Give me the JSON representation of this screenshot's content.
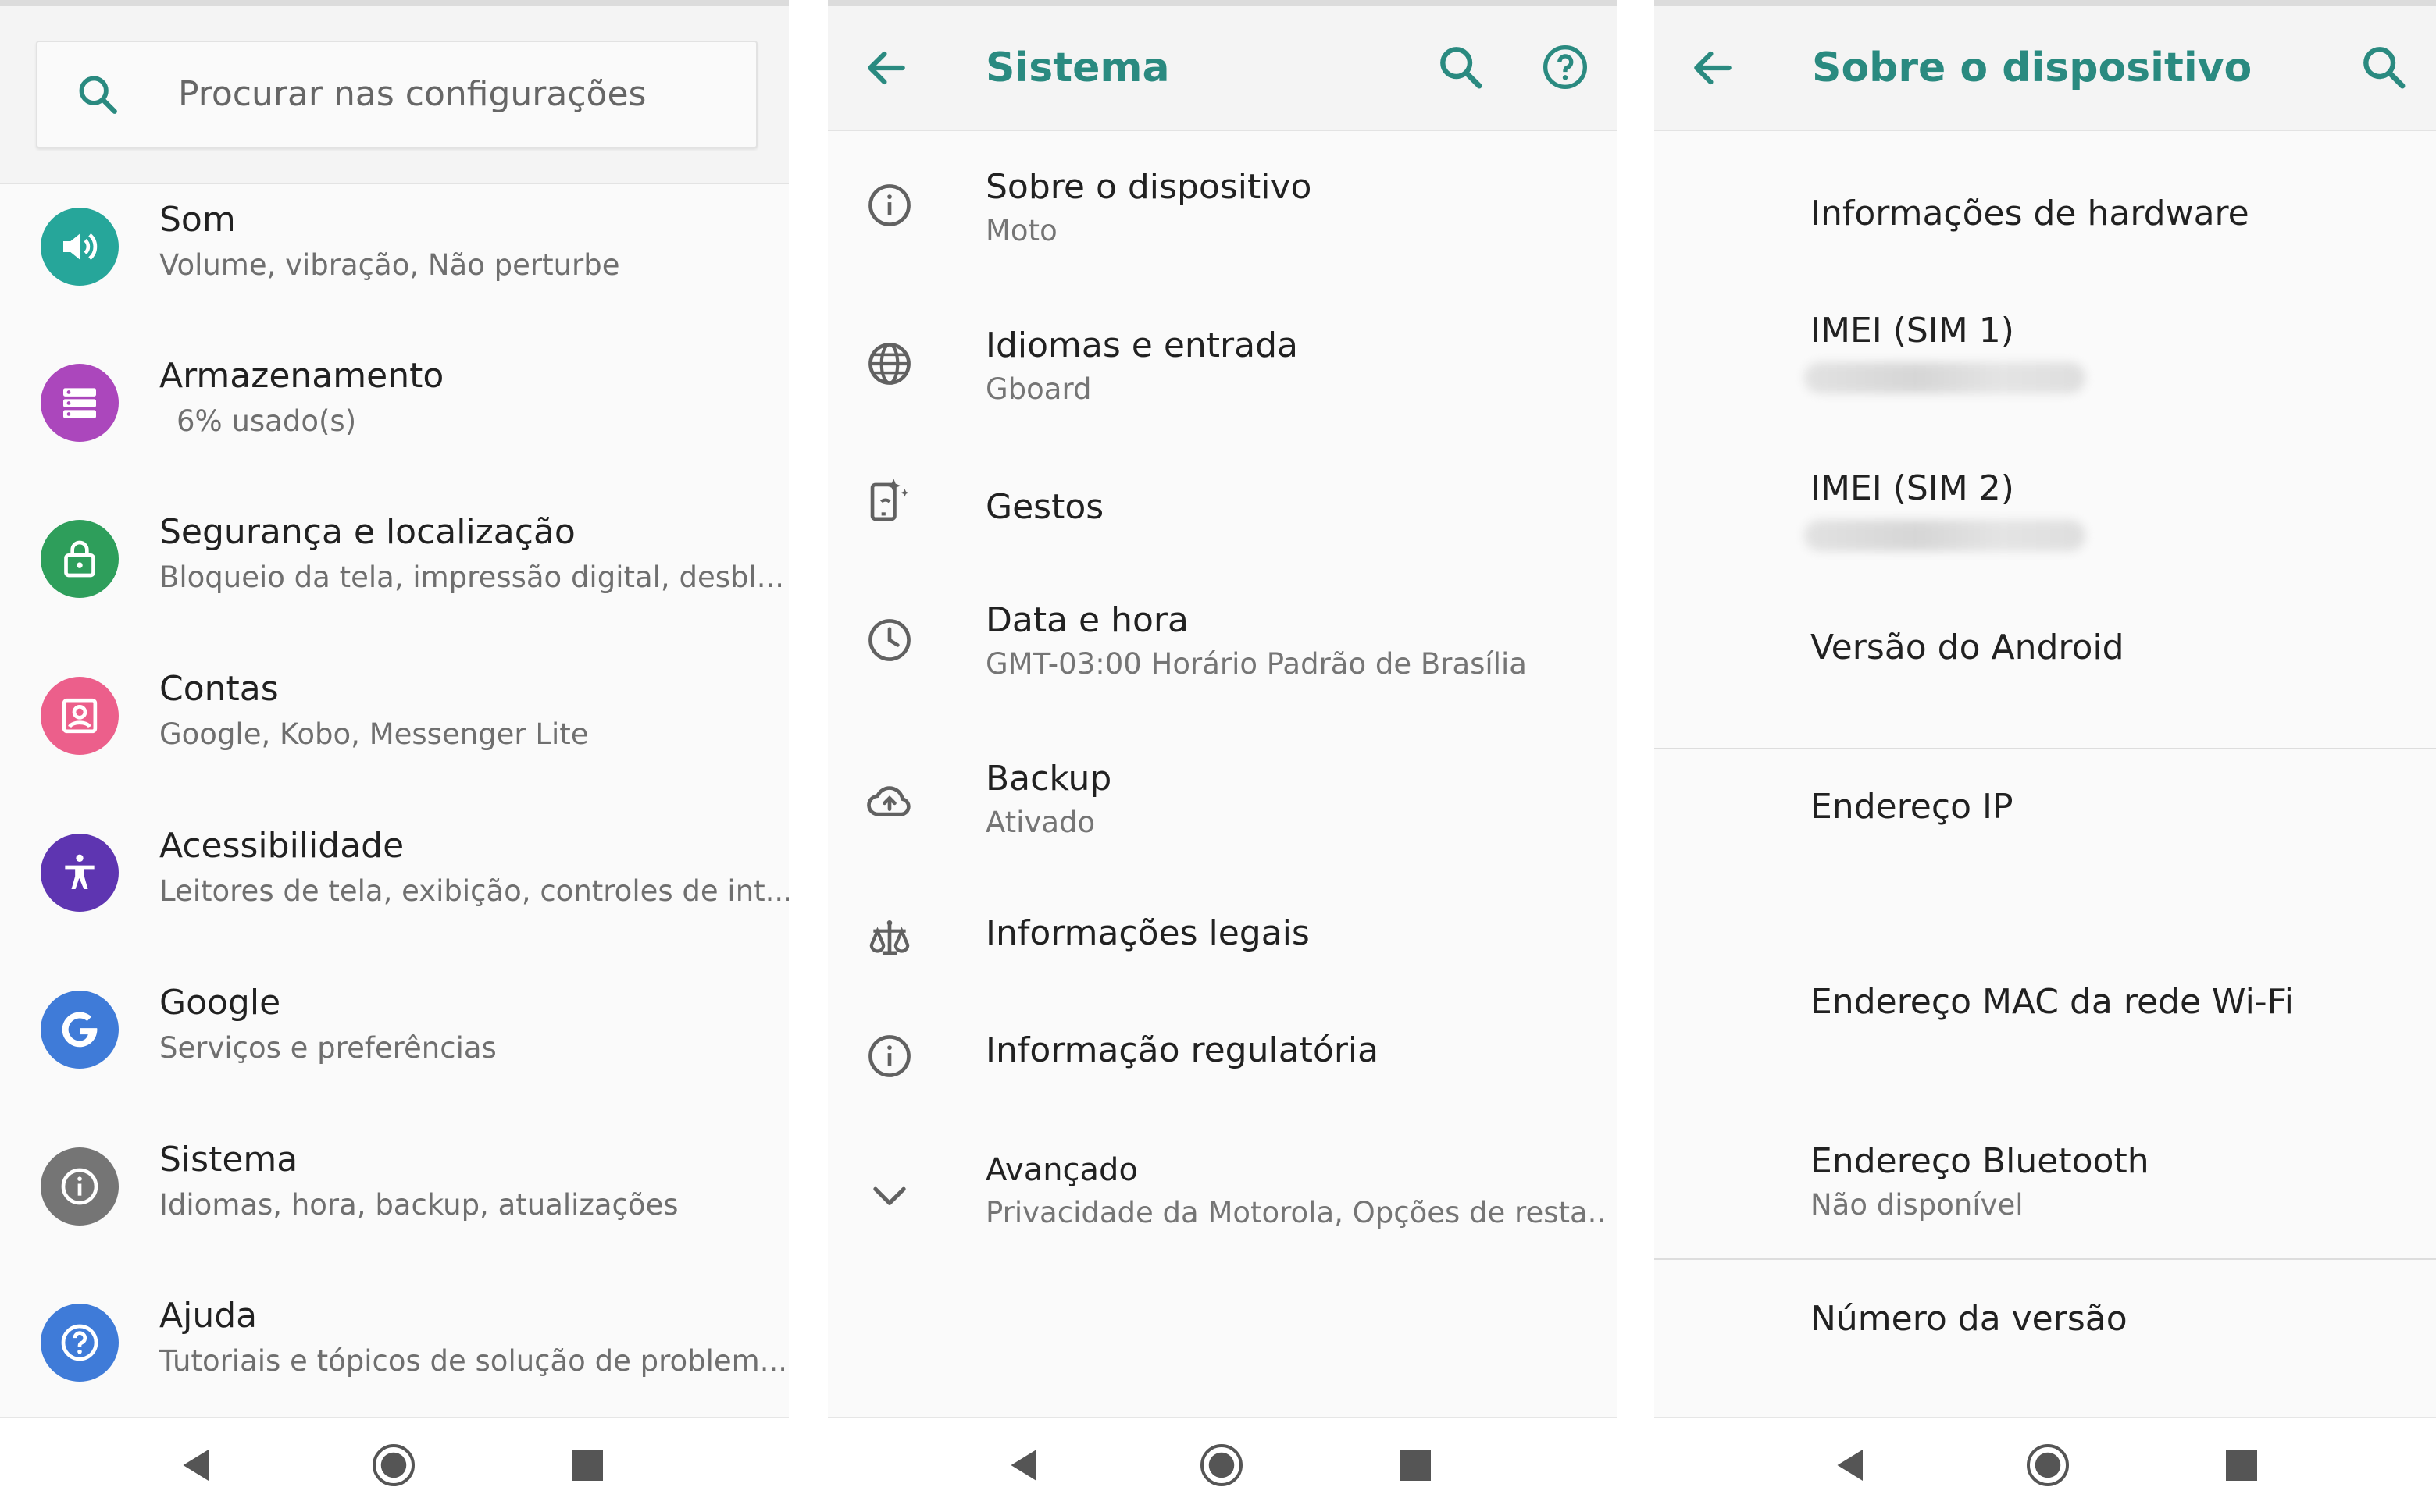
{
  "panel1": {
    "search": {
      "placeholder": "Procurar nas configurações"
    },
    "items": [
      {
        "title": "Som",
        "subtitle": "Volume, vibração, Não perturbe",
        "icon": "speaker-icon",
        "color": "#26a69a"
      },
      {
        "title": "Armazenamento",
        "subtitle": "6% usado(s)",
        "icon": "storage-icon",
        "color": "#ab47bc"
      },
      {
        "title": "Segurança e localização",
        "subtitle": "Bloqueio da tela, impressão digital, desbl...",
        "icon": "lock-icon",
        "color": "#2e9e5b"
      },
      {
        "title": "Contas",
        "subtitle": "Google, Kobo, Messenger Lite",
        "icon": "account-icon",
        "color": "#ec5f8b"
      },
      {
        "title": "Acessibilidade",
        "subtitle": "Leitores de tela, exibição, controles de int...",
        "icon": "accessibility-icon",
        "color": "#5e35b1"
      },
      {
        "title": "Google",
        "subtitle": "Serviços e preferências",
        "icon": "google-icon",
        "color": "#3f7bd8"
      },
      {
        "title": "Sistema",
        "subtitle": "Idiomas, hora, backup, atualizações",
        "icon": "info-icon",
        "color": "#757575"
      },
      {
        "title": "Ajuda",
        "subtitle": "Tutoriais e tópicos de solução de problem...",
        "icon": "help-icon",
        "color": "#3f7bd8"
      }
    ]
  },
  "panel2": {
    "title": "Sistema",
    "items": [
      {
        "title": "Sobre o dispositivo",
        "subtitle": "Moto",
        "icon": "info-icon"
      },
      {
        "title": "Idiomas e entrada",
        "subtitle": "Gboard",
        "icon": "globe-icon"
      },
      {
        "title": "Gestos",
        "subtitle": "",
        "icon": "gesture-phone-icon"
      },
      {
        "title": "Data e hora",
        "subtitle": "GMT-03:00 Horário Padrão de Brasília",
        "icon": "clock-icon"
      },
      {
        "title": "Backup",
        "subtitle": "Ativado",
        "icon": "cloud-upload-icon"
      },
      {
        "title": "Informações legais",
        "subtitle": "",
        "icon": "scales-icon"
      },
      {
        "title": "Informação regulatória",
        "subtitle": "",
        "icon": "info-icon"
      },
      {
        "title": "Avançado",
        "subtitle": "Privacidade da Motorola, Opções de resta..",
        "icon": "chevron-down-icon"
      }
    ]
  },
  "panel3": {
    "title": "Sobre o dispositivo",
    "items": [
      {
        "title": "Informações de hardware",
        "subtitle": ""
      },
      {
        "title": "IMEI (SIM 1)",
        "subtitle": ""
      },
      {
        "title": "IMEI (SIM 2)",
        "subtitle": ""
      },
      {
        "title": "Versão do Android",
        "subtitle": ""
      },
      {
        "title": "Endereço IP",
        "subtitle": ""
      },
      {
        "title": "Endereço MAC da rede Wi-Fi",
        "subtitle": ""
      },
      {
        "title": "Endereço Bluetooth",
        "subtitle": "Não disponível"
      },
      {
        "title": "Número da versão",
        "subtitle": ""
      }
    ]
  },
  "colors": {
    "accent": "#2a8a80",
    "background": "#fafafa",
    "text_primary": "#212121",
    "text_secondary": "#757575"
  },
  "navigation": {
    "buttons": [
      "back-nav-icon",
      "home-nav-icon",
      "recents-nav-icon"
    ]
  }
}
